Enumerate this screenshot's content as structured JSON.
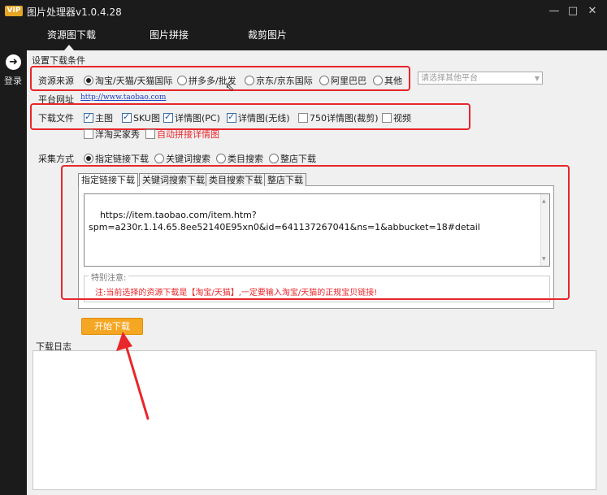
{
  "window": {
    "vip_badge": "VIP",
    "title": "图片处理器v1.0.4.28",
    "minimize": "—",
    "maximize": "□",
    "close": "✕"
  },
  "top_tabs": [
    "资源图下载",
    "图片拼接",
    "裁剪图片"
  ],
  "sidebar": {
    "login_label": "登录"
  },
  "conditions": {
    "header": "设置下载条件",
    "source": {
      "label": "资源来源",
      "options": [
        "淘宝/天猫/天猫国际",
        "拼多多/批发",
        "京东/京东国际",
        "阿里巴巴",
        "其他"
      ],
      "selected": "淘宝/天猫/天猫国际",
      "other_platform_placeholder": "请选择其他平台"
    },
    "platform_url": {
      "label": "平台网址",
      "url": "http://www.taobao.com"
    },
    "download_files": {
      "label": "下载文件",
      "options": [
        {
          "label": "主图",
          "checked": true
        },
        {
          "label": "SKU图",
          "checked": true
        },
        {
          "label": "详情图(PC)",
          "checked": true
        },
        {
          "label": "详情图(无线)",
          "checked": true
        },
        {
          "label": "750详情图(裁剪)",
          "checked": false
        },
        {
          "label": "视频",
          "checked": false
        }
      ],
      "extra_options": [
        {
          "label": "洋淘买家秀",
          "checked": false
        },
        {
          "label": "自动拼接详情图",
          "checked": false,
          "color": "#e8262b"
        }
      ]
    },
    "collect_method": {
      "label": "采集方式",
      "options": [
        "指定链接下载",
        "关键词搜索",
        "类目搜索",
        "整店下载"
      ],
      "selected": "指定链接下载"
    }
  },
  "sub_tabs": [
    "指定链接下载",
    "关键词搜索下载",
    "类目搜索下载",
    "整店下载"
  ],
  "url_input": {
    "value": "https://item.taobao.com/item.htm?\nspm=a230r.1.14.65.8ee52140E95xn0&id=641137267041&ns=1&abbucket=18#detail"
  },
  "note": {
    "title": "特别注意:",
    "text": "注:当前选择的资源下载是【淘宝/天猫】,一定要输入淘宝/天猫的正规宝贝链接!",
    "color": "#e8262b"
  },
  "start_button": {
    "label": "开始下载",
    "color": "#f5a623"
  },
  "log": {
    "title": "下载日志"
  },
  "colors": {
    "highlight": "#e8262b",
    "accent": "#f5a623",
    "dark_chrome": "#1b1b1b"
  }
}
